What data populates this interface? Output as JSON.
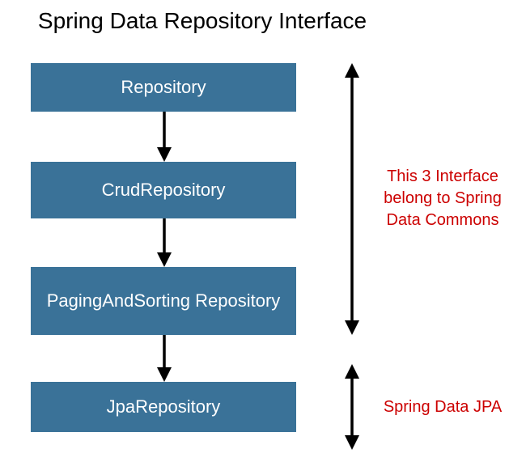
{
  "title": "Spring Data Repository Interface",
  "boxes": {
    "repository": "Repository",
    "crud": "CrudRepository",
    "paging": "PagingAndSorting Repository",
    "jpa": "JpaRepository"
  },
  "annotations": {
    "commons": "This 3 Interface belong to Spring Data Commons",
    "jpa": "Spring Data JPA"
  },
  "colors": {
    "box_fill": "#3a7298",
    "box_text": "#ffffff",
    "annotation_text": "#cc0000",
    "arrow": "#000000"
  }
}
